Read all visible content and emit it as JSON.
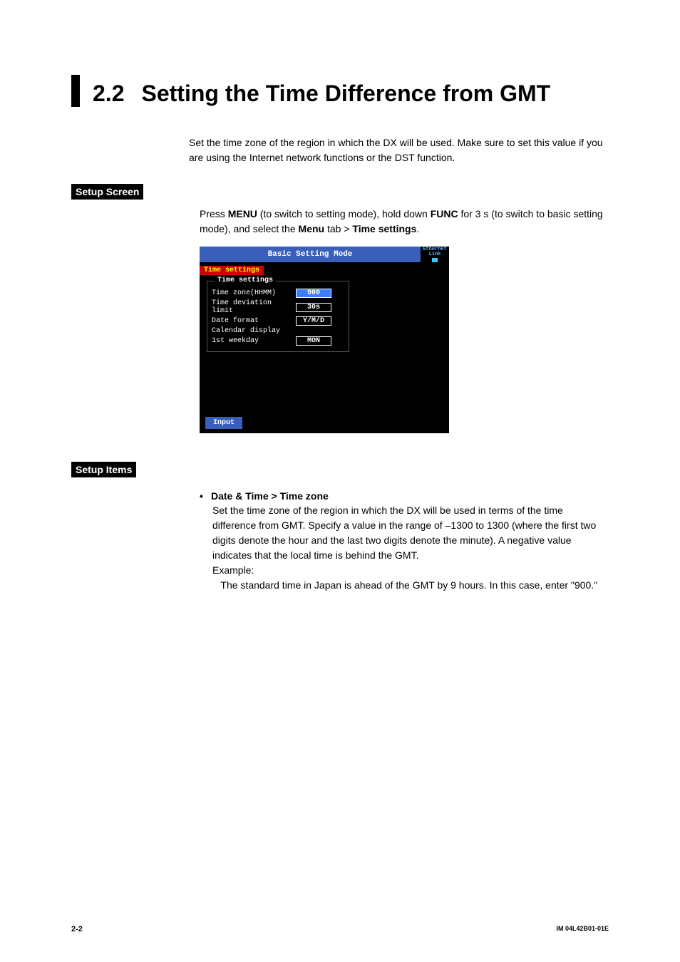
{
  "heading": {
    "number": "2.2",
    "title": "Setting the Time Difference from GMT"
  },
  "intro": "Set the time zone of the region in which the DX will be used. Make sure to set this value if you are using the Internet network functions or the DST function.",
  "section_labels": {
    "setup_screen": "Setup Screen",
    "setup_items": "Setup Items"
  },
  "instruction": {
    "pre1": "Press ",
    "menu": "MENU",
    "mid1": " (to switch to setting mode), hold down ",
    "func": "FUNC",
    "mid2": " for 3 s (to switch to basic setting mode), and select the ",
    "menu2": "Menu",
    "mid3": " tab > ",
    "time_settings": "Time settings",
    "end": "."
  },
  "screenshot": {
    "title": "Basic Setting Mode",
    "eth": "Ethernet\nLink",
    "tab": "Time settings",
    "group": "Time settings",
    "rows": [
      {
        "label": "Time zone(HHMM)",
        "value": "900",
        "selected": true
      },
      {
        "label": "Time deviation limit",
        "value": "30s",
        "selected": false
      },
      {
        "label": "Date format",
        "value": "Y/M/D",
        "selected": false
      },
      {
        "label": "Calendar display",
        "value": "",
        "selected": false
      },
      {
        "label": "1st weekday",
        "value": "MON",
        "selected": false
      }
    ],
    "input_btn": "Input"
  },
  "item": {
    "heading": "Date & Time > Time zone",
    "body": "Set the time zone of the region in which the DX will be used in terms of the time difference from GMT. Specify a value in the range of –1300 to 1300 (where the first two digits denote the hour and the last two digits denote the minute). A negative value indicates that the local time is behind the GMT.",
    "example_label": "Example:",
    "example_text": "   The standard time in Japan is ahead of the GMT by 9 hours. In this case, enter \"900.\""
  },
  "footer": {
    "page": "2-2",
    "docid": "IM 04L42B01-01E"
  }
}
